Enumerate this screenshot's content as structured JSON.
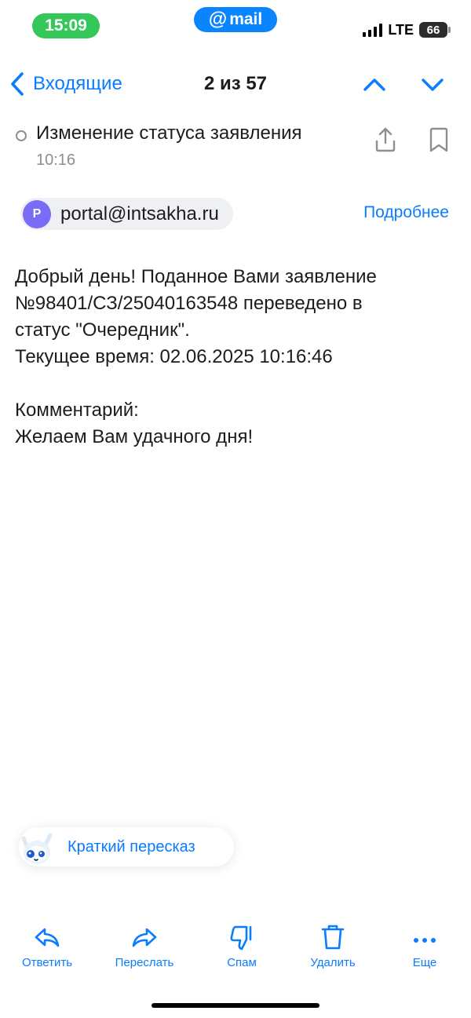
{
  "status_bar": {
    "time": "15:09",
    "app_badge": "mail",
    "network": "LTE",
    "battery": "66"
  },
  "nav": {
    "back_label": "Входящие",
    "counter": "2 из 57"
  },
  "message": {
    "subject": "Изменение статуса заявления",
    "time": "10:16",
    "sender_initial": "P",
    "sender_email": "portal@intsakha.ru",
    "details_label": "Подробнее",
    "body_lines": [
      "Добрый день! Поданное Вами заявление",
      "№98401/СЗ/25040163548 переведено в",
      "статус \"Очередник\".",
      "Текущее время: 02.06.2025 10:16:46",
      "",
      "Комментарий:",
      "Желаем Вам удачного дня!"
    ]
  },
  "summary_button": {
    "label": "Краткий пересказ"
  },
  "toolbar": {
    "reply": "Ответить",
    "forward": "Переслать",
    "spam": "Спам",
    "delete": "Удалить",
    "more": "Еще"
  },
  "colors": {
    "accent": "#0a7cff",
    "time_badge": "#34c759",
    "app_badge": "#0a84ff",
    "avatar": "#7b6cf6"
  }
}
